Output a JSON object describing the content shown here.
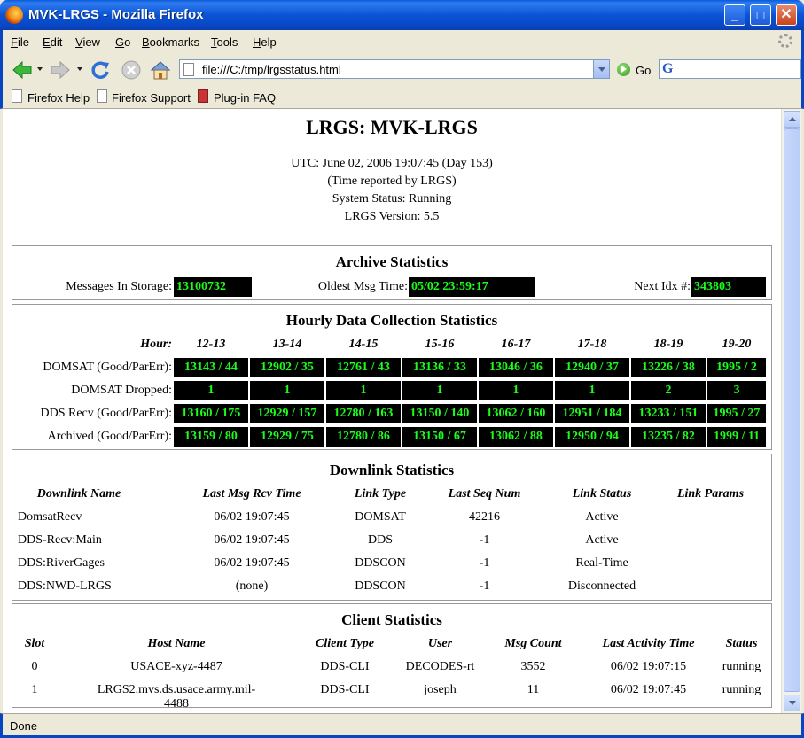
{
  "window": {
    "title": "MVK-LRGS - Mozilla Firefox"
  },
  "menu": [
    "File",
    "Edit",
    "View",
    "Go",
    "Bookmarks",
    "Tools",
    "Help"
  ],
  "nav": {
    "url": "file:///C:/tmp/lrgsstatus.html",
    "go_label": "Go",
    "search_value": ""
  },
  "bookmarks": [
    "Firefox Help",
    "Firefox Support",
    "Plug-in FAQ"
  ],
  "status_bar": "Done",
  "page": {
    "title": "LRGS: MVK-LRGS",
    "utc": "UTC: June 02, 2006 19:07:45 (Day 153)",
    "time_note": "(Time reported by LRGS)",
    "system_status": "System Status: Running",
    "version": "LRGS Version: 5.5"
  },
  "archive": {
    "title": "Archive Statistics",
    "messages_label": "Messages In Storage:",
    "messages_value": "13100732",
    "oldest_label": "Oldest Msg Time:",
    "oldest_value": "05/02 23:59:17",
    "next_label": "Next Idx #:",
    "next_value": "343803"
  },
  "hourly": {
    "title": "Hourly Data Collection Statistics",
    "hour_label": "Hour:",
    "hours": [
      "12-13",
      "13-14",
      "14-15",
      "15-16",
      "16-17",
      "17-18",
      "18-19",
      "19-20"
    ],
    "rows": [
      {
        "label": "DOMSAT (Good/ParErr):",
        "values": [
          "13143 / 44",
          "12902 / 35",
          "12761 / 43",
          "13136 / 33",
          "13046 / 36",
          "12940 / 37",
          "13226 / 38",
          "1995 / 2"
        ]
      },
      {
        "label": "DOMSAT Dropped:",
        "values": [
          "1",
          "1",
          "1",
          "1",
          "1",
          "1",
          "2",
          "3"
        ]
      },
      {
        "label": "DDS Recv (Good/ParErr):",
        "values": [
          "13160 / 175",
          "12929 / 157",
          "12780 / 163",
          "13150 / 140",
          "13062 / 160",
          "12951 / 184",
          "13233 / 151",
          "1995 / 27"
        ]
      },
      {
        "label": "Archived (Good/ParErr):",
        "values": [
          "13159 / 80",
          "12929 / 75",
          "12780 / 86",
          "13150 / 67",
          "13062 / 88",
          "12950 / 94",
          "13235 / 82",
          "1999 / 11"
        ]
      }
    ]
  },
  "downlink": {
    "title": "Downlink Statistics",
    "headers": [
      "Downlink Name",
      "Last Msg Rcv Time",
      "Link Type",
      "Last Seq Num",
      "Link Status",
      "Link Params"
    ],
    "rows": [
      [
        "DomsatRecv",
        "06/02 19:07:45",
        "DOMSAT",
        "42216",
        "Active",
        ""
      ],
      [
        "DDS-Recv:Main",
        "06/02 19:07:45",
        "DDS",
        "-1",
        "Active",
        ""
      ],
      [
        "DDS:RiverGages",
        "06/02 19:07:45",
        "DDSCON",
        "-1",
        "Real-Time",
        ""
      ],
      [
        "DDS:NWD-LRGS",
        "(none)",
        "DDSCON",
        "-1",
        "Disconnected",
        ""
      ]
    ]
  },
  "client": {
    "title": "Client Statistics",
    "headers": [
      "Slot",
      "Host Name",
      "Client Type",
      "User",
      "Msg Count",
      "Last Activity Time",
      "Status"
    ],
    "rows": [
      [
        "0",
        "USACE-xyz-4487",
        "DDS-CLI",
        "DECODES-rt",
        "3552",
        "06/02 19:07:15",
        "running"
      ],
      [
        "1",
        "LRGS2.mvs.ds.usace.army.mil-4488",
        "DDS-CLI",
        "joseph",
        "11",
        "06/02 19:07:45",
        "running"
      ]
    ]
  }
}
